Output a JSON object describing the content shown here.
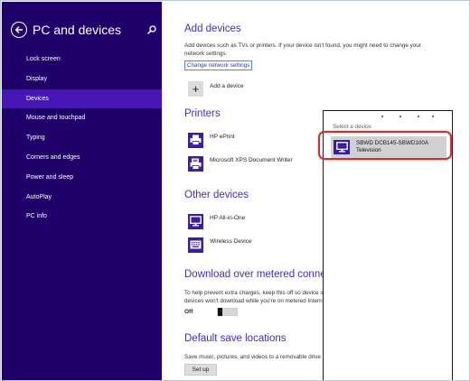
{
  "sidebar": {
    "title": "PC and devices",
    "items": [
      {
        "label": "Lock screen"
      },
      {
        "label": "Display"
      },
      {
        "label": "Devices"
      },
      {
        "label": "Mouse and touchpad"
      },
      {
        "label": "Typing"
      },
      {
        "label": "Corners and edges"
      },
      {
        "label": "Power and sleep"
      },
      {
        "label": "AutoPlay"
      },
      {
        "label": "PC info"
      }
    ],
    "active_item": "Devices"
  },
  "add_devices": {
    "heading": "Add devices",
    "description_line1": "Add devices such as TVs or printers. If your device isn't found, you might need to change your",
    "description_line2": "network settings.",
    "link": "Change network settings",
    "add_label": "Add a device",
    "add_symbol": "+"
  },
  "printers": {
    "heading": "Printers",
    "items": [
      {
        "label": "HP ePrint",
        "icon": "printer-icon"
      },
      {
        "label": "Microsoft XPS Document Writer",
        "icon": "document-writer-icon"
      }
    ]
  },
  "other_devices": {
    "heading": "Other devices",
    "items": [
      {
        "label": "HP All-in-One",
        "icon": "monitor-icon"
      },
      {
        "label": "Wireless Device",
        "icon": "keyboard-icon"
      }
    ]
  },
  "metered": {
    "heading": "Download over metered conne",
    "description_line1": "To help prevent extra charges, keep this off so device so",
    "description_line2": "devices won't download while you're on metered Intern",
    "toggle_state": "Off"
  },
  "default_save": {
    "heading": "Default save locations",
    "description": "Save music, pictures, and videos to a removable drive by default",
    "button": "Set up"
  },
  "popup": {
    "title": "Select a device",
    "item_name": "SBWD DCB145-SBWD100A",
    "item_type": "Television",
    "icon": "monitor-icon"
  },
  "colors": {
    "sidebar_bg": "#1f0068",
    "sidebar_active": "#4617b4",
    "heading": "#3e2ec2",
    "icon_bg": "#3c1e9b",
    "highlight": "#d32f2f"
  }
}
